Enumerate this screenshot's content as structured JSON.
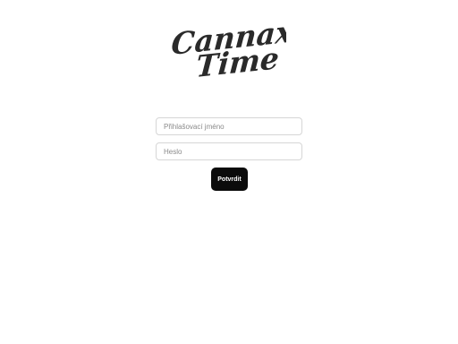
{
  "brand": {
    "logo_text": "Cannax Time",
    "logo_line1": "Cannax",
    "logo_line2": "Time",
    "color": "#2a2a2a"
  },
  "login": {
    "username_placeholder": "Přihlašovací jméno",
    "username_value": "",
    "password_placeholder": "Heslo",
    "password_value": "",
    "submit_label": "Potvrdit"
  },
  "colors": {
    "button_bg": "#0b0b0b",
    "button_text": "#ffffff",
    "field_border": "#d6d6d6",
    "placeholder": "#8a8a8a"
  }
}
